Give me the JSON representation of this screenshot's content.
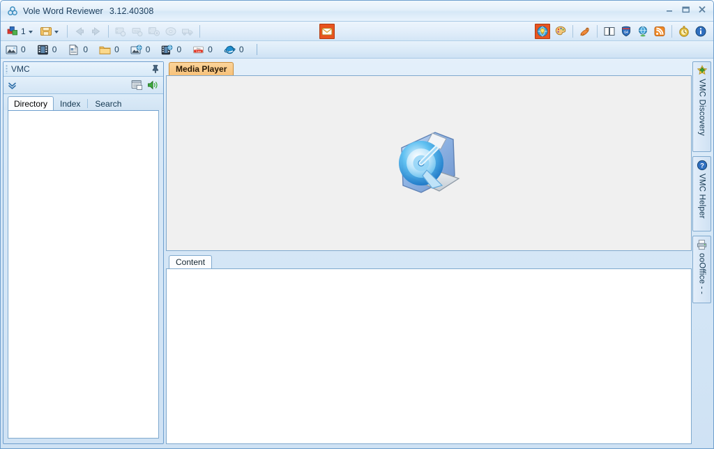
{
  "window": {
    "title": "Vole Word Reviewer",
    "version": "3.12.40308",
    "app_icon": "vole-logo-icon",
    "controls": {
      "minimize": "minimize-icon",
      "maximize": "maximize-icon",
      "close": "close-icon"
    }
  },
  "main_toolbar": {
    "items": [
      {
        "name": "add-media-button",
        "icon": "colored-blocks-icon",
        "value": "1",
        "has_caret": true,
        "enabled": true
      },
      {
        "name": "save-folder-button",
        "icon": "folder-save-icon",
        "has_caret": true,
        "enabled": true
      },
      {
        "name": "back-button",
        "icon": "arrow-left-icon",
        "enabled": false
      },
      {
        "name": "forward-button",
        "icon": "arrow-right-icon",
        "enabled": false
      },
      {
        "name": "extract-video-button",
        "icon": "film-extract-icon",
        "enabled": false
      },
      {
        "name": "youtube-download-button",
        "icon": "youtube-download-icon",
        "enabled": false
      },
      {
        "name": "film-settings-button",
        "icon": "film-gear-icon",
        "enabled": false
      },
      {
        "name": "convert-button",
        "icon": "convert-disc-icon",
        "enabled": false
      },
      {
        "name": "batch-button",
        "icon": "batch-truck-icon",
        "enabled": false
      }
    ],
    "right_items": [
      {
        "name": "mail-button",
        "icon": "envelope-icon",
        "highlighted": true,
        "highlight_color": "#e8541f"
      },
      {
        "name": "discovery-button",
        "icon": "globe-bulb-icon",
        "highlighted": true,
        "highlight_color": "#e8541f"
      },
      {
        "name": "palette-button",
        "icon": "palette-icon"
      },
      {
        "name": "mascot-button",
        "icon": "fox-mascot-icon"
      },
      {
        "name": "book-button",
        "icon": "open-book-icon"
      },
      {
        "name": "highway-button",
        "icon": "highway-shield-icon"
      },
      {
        "name": "globe-button",
        "icon": "blue-globe-icon"
      },
      {
        "name": "rss-button",
        "icon": "rss-feed-icon"
      },
      {
        "name": "timer-button",
        "icon": "stopwatch-icon"
      },
      {
        "name": "info-button",
        "icon": "info-icon"
      }
    ]
  },
  "counter_bar": {
    "counters": [
      {
        "name": "counter-images",
        "icon": "picture-icon",
        "value": "0"
      },
      {
        "name": "counter-videos",
        "icon": "filmstrip-icon",
        "value": "0"
      },
      {
        "name": "counter-documents",
        "icon": "document-icon",
        "value": "0"
      },
      {
        "name": "counter-folders",
        "icon": "folder-icon",
        "value": "0"
      },
      {
        "name": "counter-web-images",
        "icon": "picture-globe-icon",
        "value": "0"
      },
      {
        "name": "counter-web-videos",
        "icon": "filmstrip-globe-icon",
        "value": "0"
      },
      {
        "name": "counter-youtube",
        "icon": "youtube-icon",
        "value": "0"
      },
      {
        "name": "counter-browser",
        "icon": "internet-explorer-icon",
        "value": "0"
      }
    ]
  },
  "left_dock": {
    "title": "VMC",
    "pin_icon": "pushpin-icon",
    "toolbar": {
      "chevron_icon": "double-chevron-down-icon",
      "buttons": [
        {
          "name": "notes-button",
          "icon": "note-window-icon"
        },
        {
          "name": "speaker-button",
          "icon": "speaker-icon"
        }
      ]
    },
    "tabs": [
      {
        "name": "tab-directory",
        "label": "Directory",
        "active": true
      },
      {
        "name": "tab-index",
        "label": "Index",
        "active": false
      },
      {
        "name": "tab-search",
        "label": "Search",
        "active": false
      }
    ],
    "list_items": []
  },
  "center": {
    "media_pane": {
      "tab_label": "Media Player",
      "logo_icon": "quicktime-folder-icon",
      "background_color": "#f0f0f0"
    },
    "content_pane": {
      "tab_label": "Content",
      "background_color": "#ffffff",
      "text": ""
    }
  },
  "right_strip": {
    "tabs": [
      {
        "name": "vtab-vmc-discovery",
        "label": "VMC Discovery",
        "icon": "green-star-plus-icon"
      },
      {
        "name": "vtab-vmc-helper",
        "label": "VMC Helper",
        "icon": "blue-question-icon"
      },
      {
        "name": "vtab-ooffice",
        "label": "ooOffice - -",
        "icon": "office-printer-icon"
      }
    ]
  },
  "colors": {
    "accent_orange": "#e8541f",
    "tab_active_orange": "#f7c27a",
    "frame_blue": "#6f9fce",
    "panel_bg": "#cfe2f4"
  }
}
